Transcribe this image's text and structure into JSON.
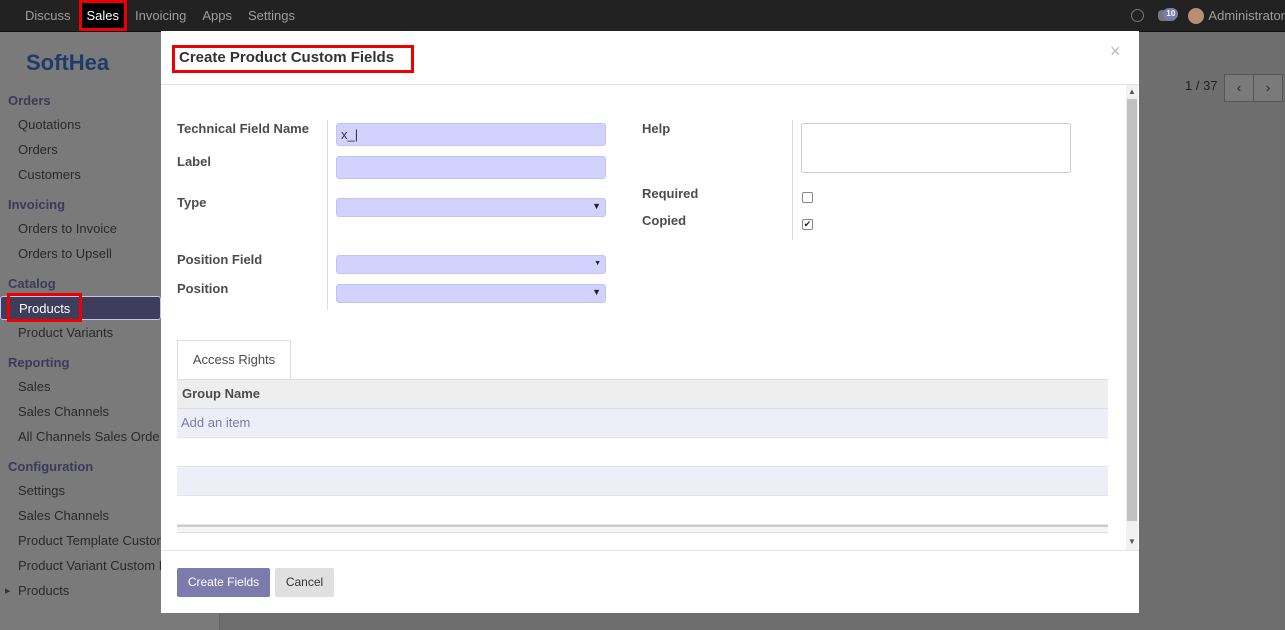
{
  "navbar": {
    "menu": [
      "Discuss",
      "Sales",
      "Invoicing",
      "Apps",
      "Settings"
    ],
    "active": "Sales",
    "chat_count": "10",
    "user": "Administrator"
  },
  "sidebar": {
    "logo": "SoftHea",
    "sections": [
      {
        "title": "Orders",
        "items": [
          "Quotations",
          "Orders",
          "Customers"
        ]
      },
      {
        "title": "Invoicing",
        "items": [
          "Orders to Invoice",
          "Orders to Upsell"
        ]
      },
      {
        "title": "Catalog",
        "items": [
          "Products",
          "Product Variants"
        ]
      },
      {
        "title": "Reporting",
        "items": [
          "Sales",
          "Sales Channels",
          "All Channels Sales Orde"
        ]
      },
      {
        "title": "Configuration",
        "items": [
          "Settings",
          "Sales Channels",
          "Product Template Custor",
          "Product Variant Custom I",
          "Products"
        ]
      }
    ],
    "selected": "Products"
  },
  "pager": {
    "text": "1 / 37"
  },
  "modal": {
    "title": "Create Product Custom Fields",
    "close": "×",
    "fields": {
      "technical_name_label": "Technical Field Name",
      "technical_name_value": "x_|",
      "label_label": "Label",
      "label_value": "",
      "type_label": "Type",
      "position_field_label": "Position Field",
      "position_label": "Position",
      "help_label": "Help",
      "required_label": "Required",
      "required_checked": false,
      "copied_label": "Copied",
      "copied_checked": true
    },
    "tab": "Access Rights",
    "table": {
      "header": "Group Name",
      "add_item": "Add an item"
    },
    "buttons": {
      "create": "Create Fields",
      "cancel": "Cancel"
    }
  },
  "colors": {
    "accent": "#7c7bad",
    "input_bg": "#d2d2ff",
    "highlight": "#ee0000"
  }
}
